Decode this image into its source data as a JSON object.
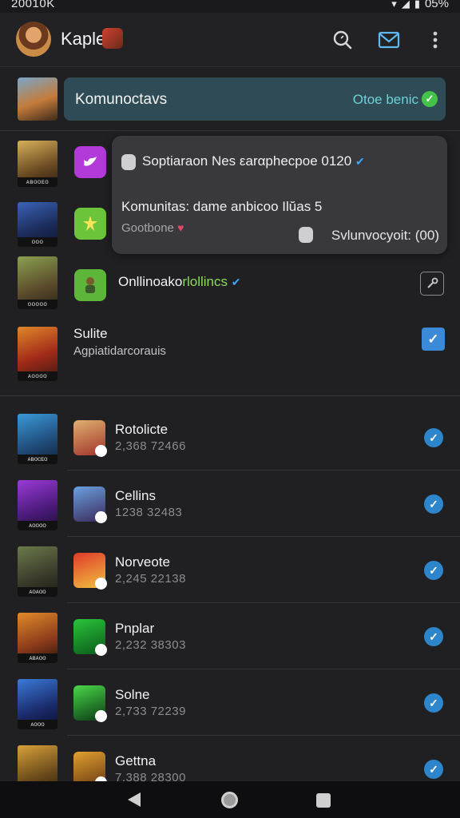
{
  "status_bar": {
    "time": "20010K",
    "right_text": "05%"
  },
  "app_bar": {
    "title": "Kaple"
  },
  "banner": {
    "title": "Komunoctavs",
    "action": "Otoe benic"
  },
  "popup": {
    "line1": "Soptiaraon Nes εarαphecpoe 0120",
    "line2": "Komunitas: dame anbicoo  Ilŭas 5",
    "line3": "Gootbone",
    "line4": "Svlunvocyoit: (00)"
  },
  "rows": {
    "online_prefix": "Onllinoako",
    "online_accent": "rlollincs",
    "suite_title": "Sulite",
    "suite_sub": "Agpiatidarcorauis"
  },
  "games": [
    {
      "name": "Rotolicte",
      "count": "2,368 72466",
      "thumb_caption": "ᴀʙᴏᴄᴇᴏ"
    },
    {
      "name": "Cellins",
      "count": "1238 32483",
      "thumb_caption": "ᴀᴏᴏᴏᴏ"
    },
    {
      "name": "Norveote",
      "count": "2,245 22138",
      "thumb_caption": "ᴀᴏᴀᴏᴏ"
    },
    {
      "name": "Pnplar",
      "count": "2,232 38303",
      "thumb_caption": "ᴀʙᴀᴏᴏ"
    },
    {
      "name": "Solne",
      "count": "2,733 72239",
      "thumb_caption": "ᴀᴏᴏᴏ"
    },
    {
      "name": "Gettna",
      "count": "7,388 28300",
      "thumb_caption": ""
    }
  ],
  "thumb_captions": {
    "t1": "ᴀʙᴏᴏᴇᴏ",
    "t2": "ᴏᴏᴏ",
    "t3": "ᴏᴏᴏᴏᴏ",
    "t4": "ᴀᴏᴏᴏᴏ"
  },
  "icons": {
    "search": "search-icon",
    "mail": "mail-icon",
    "more": "more-vert-icon",
    "verified": "verified-icon",
    "check": "check-icon",
    "tool": "wrench-icon"
  },
  "colors": {
    "accent_blue": "#2d86cc",
    "banner_bg": "#2f4b55",
    "online_green": "#8cd95a",
    "check_green": "#45c24a"
  }
}
